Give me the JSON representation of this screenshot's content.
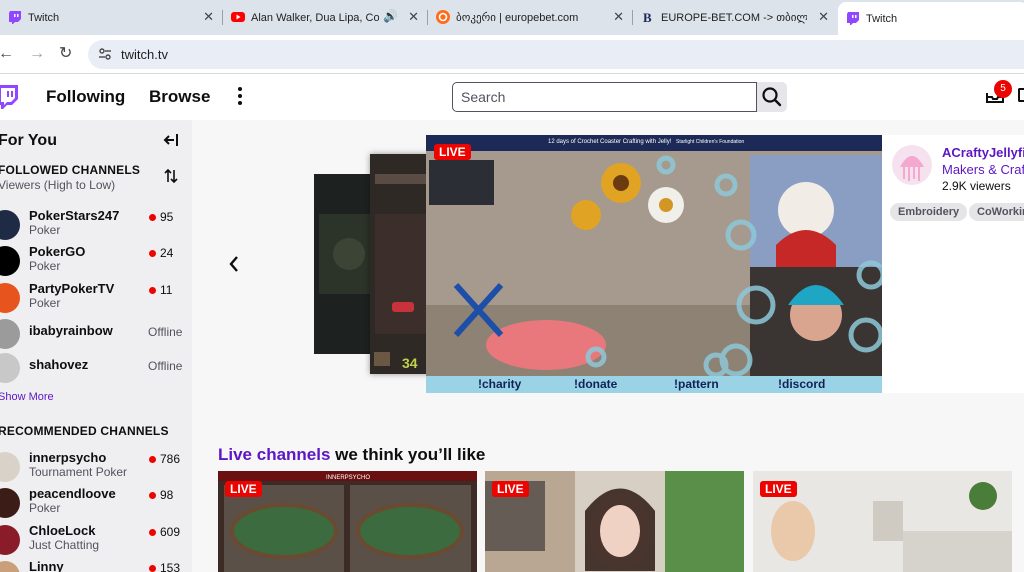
{
  "browser": {
    "tabs": [
      {
        "label": "Twitch",
        "favicon_color": "#9146ff",
        "active": false
      },
      {
        "label": "Alan Walker, Dua Lipa, Cold",
        "favicon_color": "#ff0000",
        "active": false
      },
      {
        "label": "ბოკერი | europebet.com",
        "favicon_color": "#ff6b1a",
        "active": false
      },
      {
        "label": "EUROPE-BET.COM -> თბილის",
        "favicon_color": "#1d2a57",
        "active": false
      },
      {
        "label": "Twitch",
        "favicon_color": "#9146ff",
        "active": true
      }
    ],
    "url": "twitch.tv"
  },
  "topnav": {
    "following": "Following",
    "browse": "Browse",
    "search_placeholder": "Search",
    "notification_count": "5"
  },
  "sidebar": {
    "title": "For You",
    "followed_header": "FOLLOWED CHANNELS",
    "sort_label": "Viewers (High to Low)",
    "followed": [
      {
        "name": "PokerStars247",
        "category": "Poker",
        "viewers": "95",
        "live": true,
        "avatar_color": "#1f2a44"
      },
      {
        "name": "PokerGO",
        "category": "Poker",
        "viewers": "24",
        "live": true,
        "avatar_color": "#000000"
      },
      {
        "name": "PartyPokerTV",
        "category": "Poker",
        "viewers": "11",
        "live": true,
        "avatar_color": "#e8541d"
      },
      {
        "name": "ibabyrainbow",
        "category": "",
        "viewers": "",
        "status": "Offline",
        "live": false,
        "avatar_color": "#9b9b9b"
      },
      {
        "name": "shahovez",
        "category": "",
        "viewers": "",
        "status": "Offline",
        "live": false,
        "avatar_color": "#c8c8c8"
      }
    ],
    "show_more": "Show More",
    "recommended_header": "RECOMMENDED CHANNELS",
    "recommended": [
      {
        "name": "innerpsycho",
        "category": "Tournament Poker",
        "viewers": "786",
        "avatar_color": "#d9d2c8"
      },
      {
        "name": "peacendloove",
        "category": "Poker",
        "viewers": "98",
        "avatar_color": "#3b1c16"
      },
      {
        "name": "ChloeLock",
        "category": "Just Chatting",
        "viewers": "609",
        "avatar_color": "#8a1c2a"
      },
      {
        "name": "Linny",
        "category": "",
        "viewers": "153",
        "avatar_color": "#c9a07a"
      }
    ]
  },
  "featured": {
    "live_label": "LIVE",
    "channel": "ACraftyJellyfish",
    "category": "Makers & Crafting",
    "viewers": "2.9K viewers",
    "tags": [
      "Embroidery",
      "CoWorking"
    ],
    "overlay_top": "12 days of Crochet Coaster Crafting with Jelly!",
    "overlay_charity": "Starlight Children's Foundation",
    "commands": [
      "!charity",
      "!donate",
      "!pattern",
      "!discord"
    ]
  },
  "live_channels": {
    "title_accent": "Live channels",
    "title_rest": " we think you’ll like",
    "cards": [
      {
        "live_label": "LIVE",
        "overlay": "INNERPSYCHO",
        "bg": "#3b2a26"
      },
      {
        "live_label": "LIVE",
        "overlay": "",
        "bg": "#d8cfc4"
      },
      {
        "live_label": "LIVE",
        "overlay": "",
        "bg": "#e9e7e3"
      }
    ]
  },
  "colors": {
    "brand": "#9146ff",
    "accent": "#5c16c5",
    "live": "#eb0400"
  }
}
